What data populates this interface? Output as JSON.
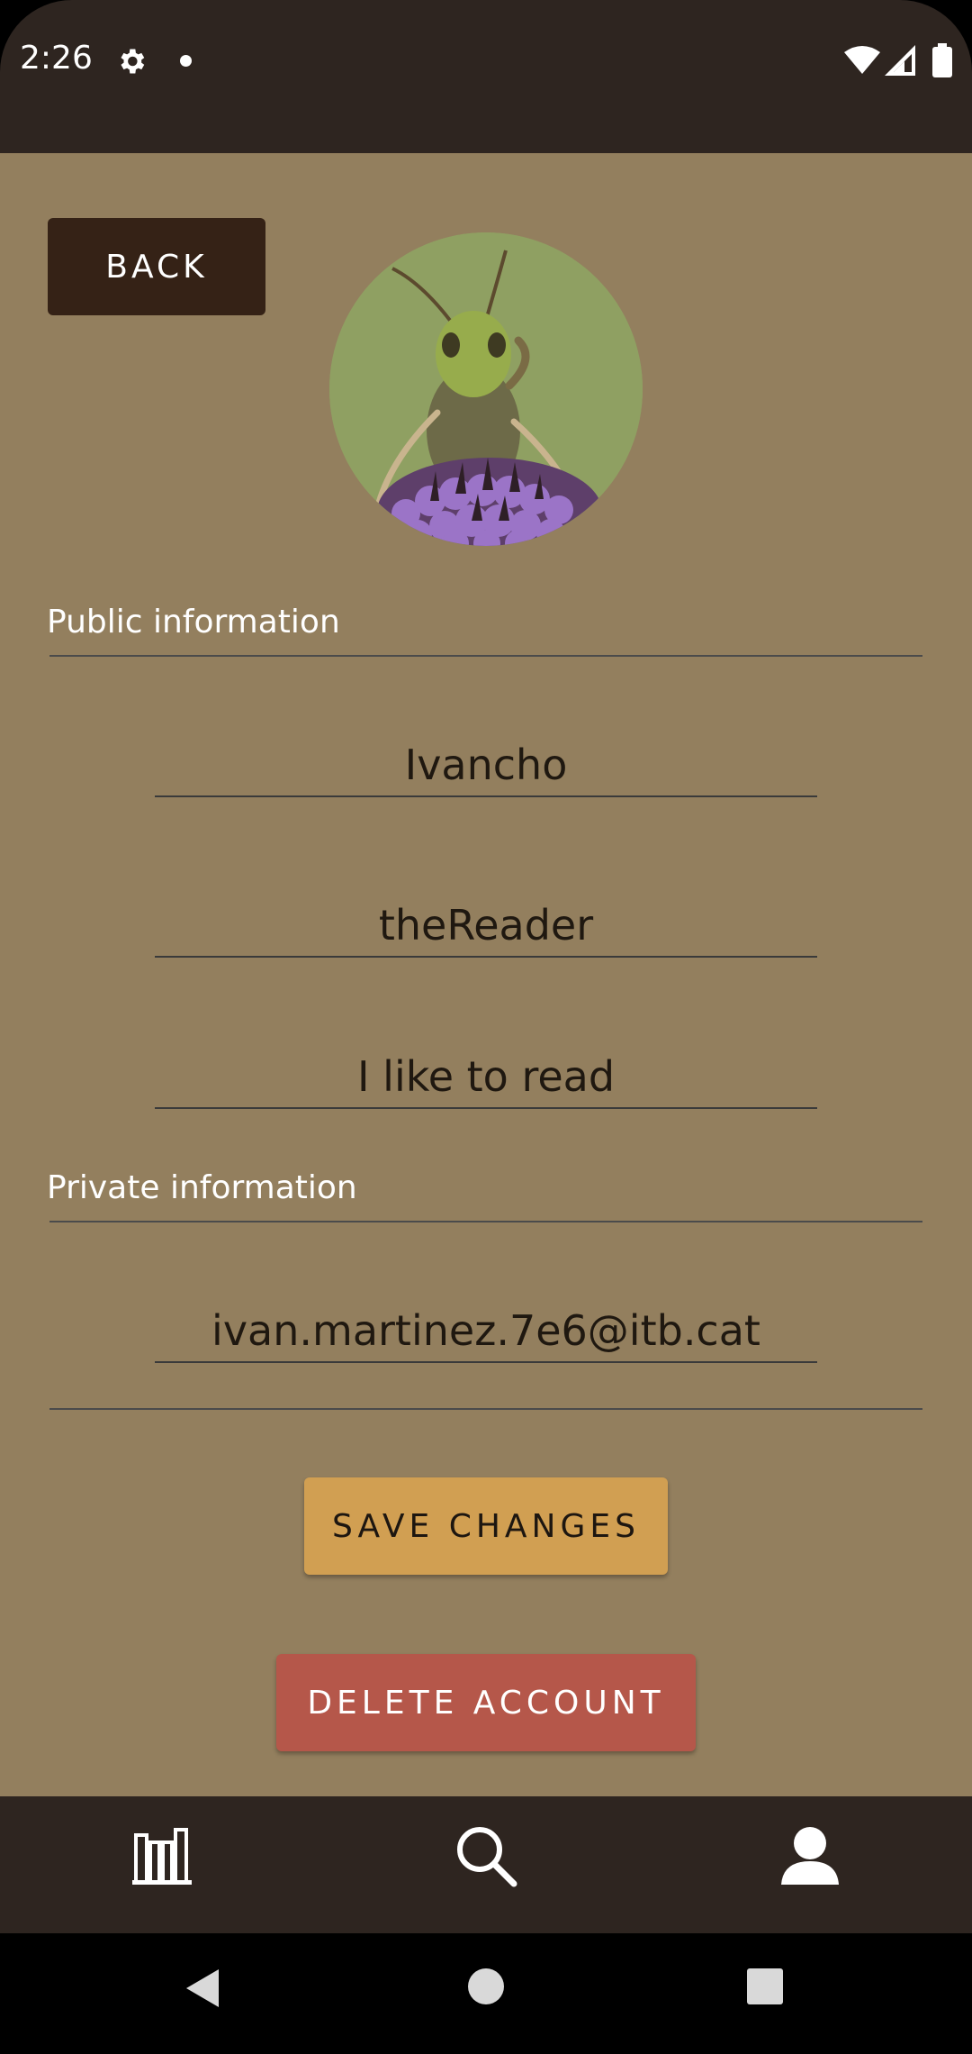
{
  "status_bar": {
    "time": "2:26",
    "icons": [
      "gear-icon",
      "notification-dot-icon",
      "wifi-icon",
      "signal-icon",
      "battery-icon"
    ]
  },
  "header": {
    "back_label": "BACK"
  },
  "profile": {
    "avatar": "grasshopper-on-purple-flower"
  },
  "public_section": {
    "label": "Public information",
    "name": "Ivancho",
    "username": "theReader",
    "bio": "I like to read"
  },
  "private_section": {
    "label": "Private information",
    "email": "ivan.martinez.7e6@itb.cat"
  },
  "actions": {
    "save_label": "SAVE CHANGES",
    "delete_label": "DELETE ACCOUNT"
  },
  "bottom_nav": {
    "items": [
      "library-icon",
      "search-icon",
      "profile-icon"
    ]
  },
  "system_nav": {
    "items": [
      "back-triangle-icon",
      "home-circle-icon",
      "recents-square-icon"
    ]
  },
  "colors": {
    "background": "#937f5e",
    "bars": "#2e2520",
    "back_button": "#352216",
    "save_button": "#d19f52",
    "delete_button": "#b5574a"
  }
}
